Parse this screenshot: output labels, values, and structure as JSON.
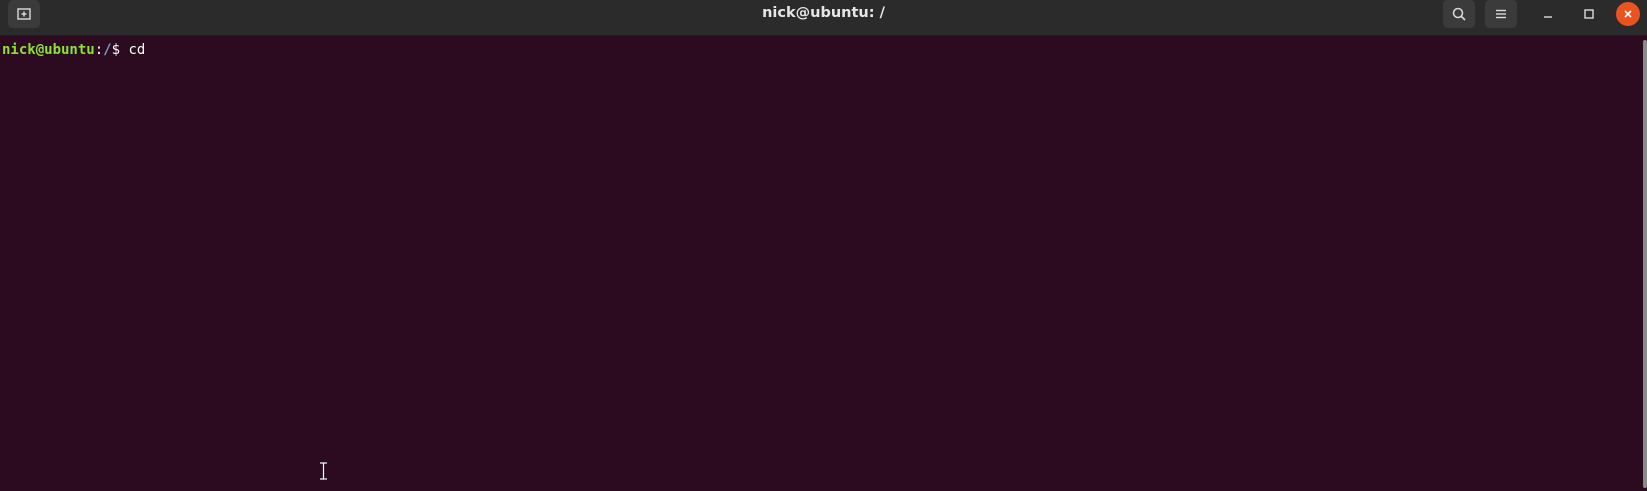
{
  "window": {
    "title": "nick@ubuntu: /"
  },
  "icons": {
    "new_tab": "new-tab-icon",
    "search": "search-icon",
    "menu": "hamburger-menu-icon",
    "minimize": "minimize-icon",
    "maximize": "maximize-icon",
    "close": "close-icon",
    "cursor": "text-cursor-icon"
  },
  "terminal": {
    "prompt_user": "nick@ubuntu",
    "prompt_sep": ":",
    "prompt_path": "/",
    "prompt_symbol": "$ ",
    "command": "cd"
  },
  "colors": {
    "terminal_bg": "#2c0a20",
    "prompt_user": "#89e234",
    "prompt_path": "#729fcf",
    "close_button": "#e95420"
  }
}
